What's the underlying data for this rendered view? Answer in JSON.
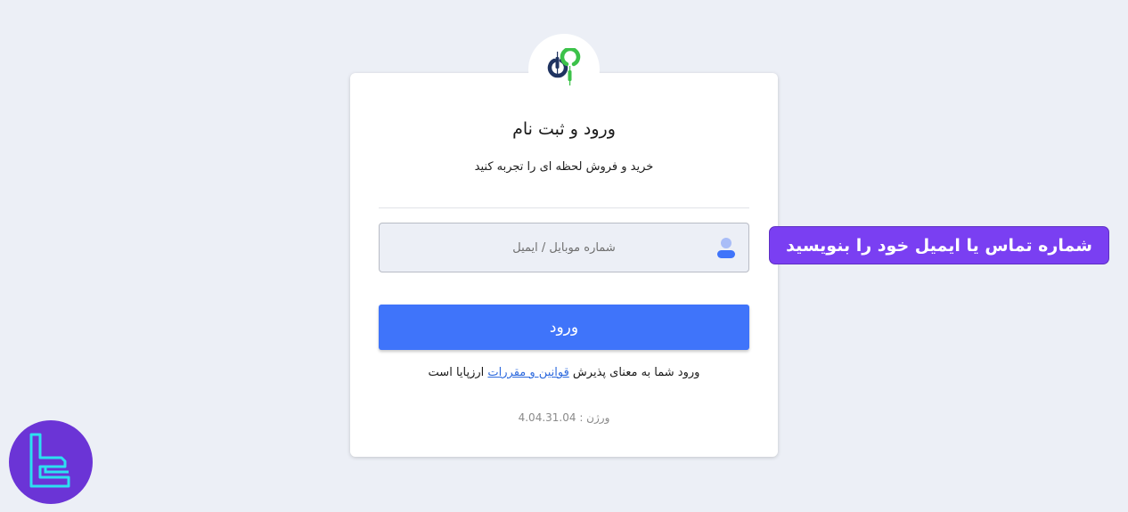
{
  "login": {
    "title": "ورود و ثبت نام",
    "subtitle": "خرید و فروش لحظه ای را تجربه کنید",
    "input_placeholder": "شماره موبایل / ایمیل",
    "submit_label": "ورود",
    "terms_prefix": "ورود شما به معنای پذیرش ",
    "terms_link": "قوانین و مقررات",
    "terms_suffix": " ارزپایا است",
    "version": "ورژن : 4.04.31.04"
  },
  "annotation": {
    "callout_text": "شماره تماس یا ایمیل خود را بنویسید"
  },
  "icons": {
    "logo": "arzpaya-logo-icon",
    "user": "user-icon",
    "badge": "tradingfinder-logo-icon"
  },
  "colors": {
    "accent": "#3f74fa",
    "callout": "#7a3ff2",
    "logo_dark": "#1f3360",
    "logo_green": "#3cc24a",
    "badge_bg": "#6b34d6",
    "badge_fg": "#2ce0f0"
  }
}
